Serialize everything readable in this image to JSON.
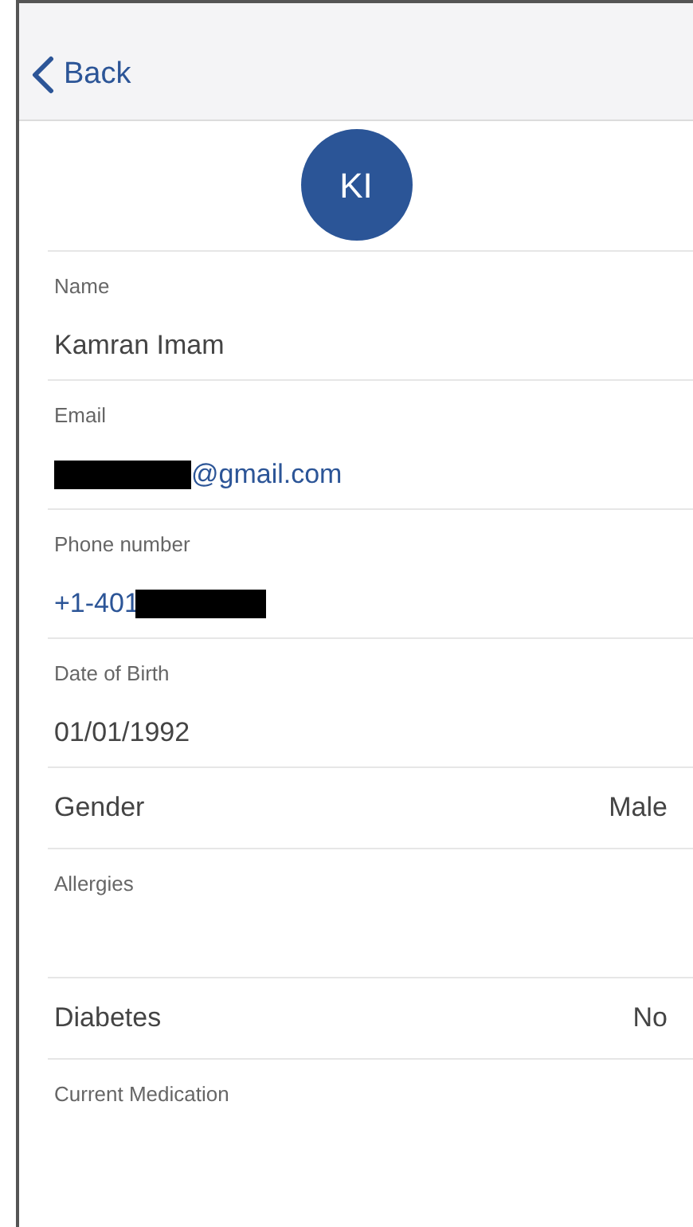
{
  "nav": {
    "back_label": "Back"
  },
  "avatar": {
    "initials": "KI"
  },
  "fields": [
    {
      "kind": "stacked",
      "label": "Name",
      "value": "Kamran Imam",
      "link": false
    },
    {
      "kind": "stacked",
      "label": "Email",
      "value": "@gmail.com",
      "link": true,
      "redacted_prefix": true
    },
    {
      "kind": "stacked",
      "label": "Phone number",
      "value": "+1-401",
      "link": true,
      "redacted_suffix": true
    },
    {
      "kind": "stacked",
      "label": "Date of Birth",
      "value": "01/01/1992",
      "link": false
    },
    {
      "kind": "inline",
      "label": "Gender",
      "value": "Male"
    },
    {
      "kind": "stacked",
      "label": "Allergies"
    },
    {
      "kind": "inline",
      "label": "Diabetes",
      "value": "No"
    },
    {
      "kind": "stacked",
      "label": "Current Medication"
    }
  ]
}
